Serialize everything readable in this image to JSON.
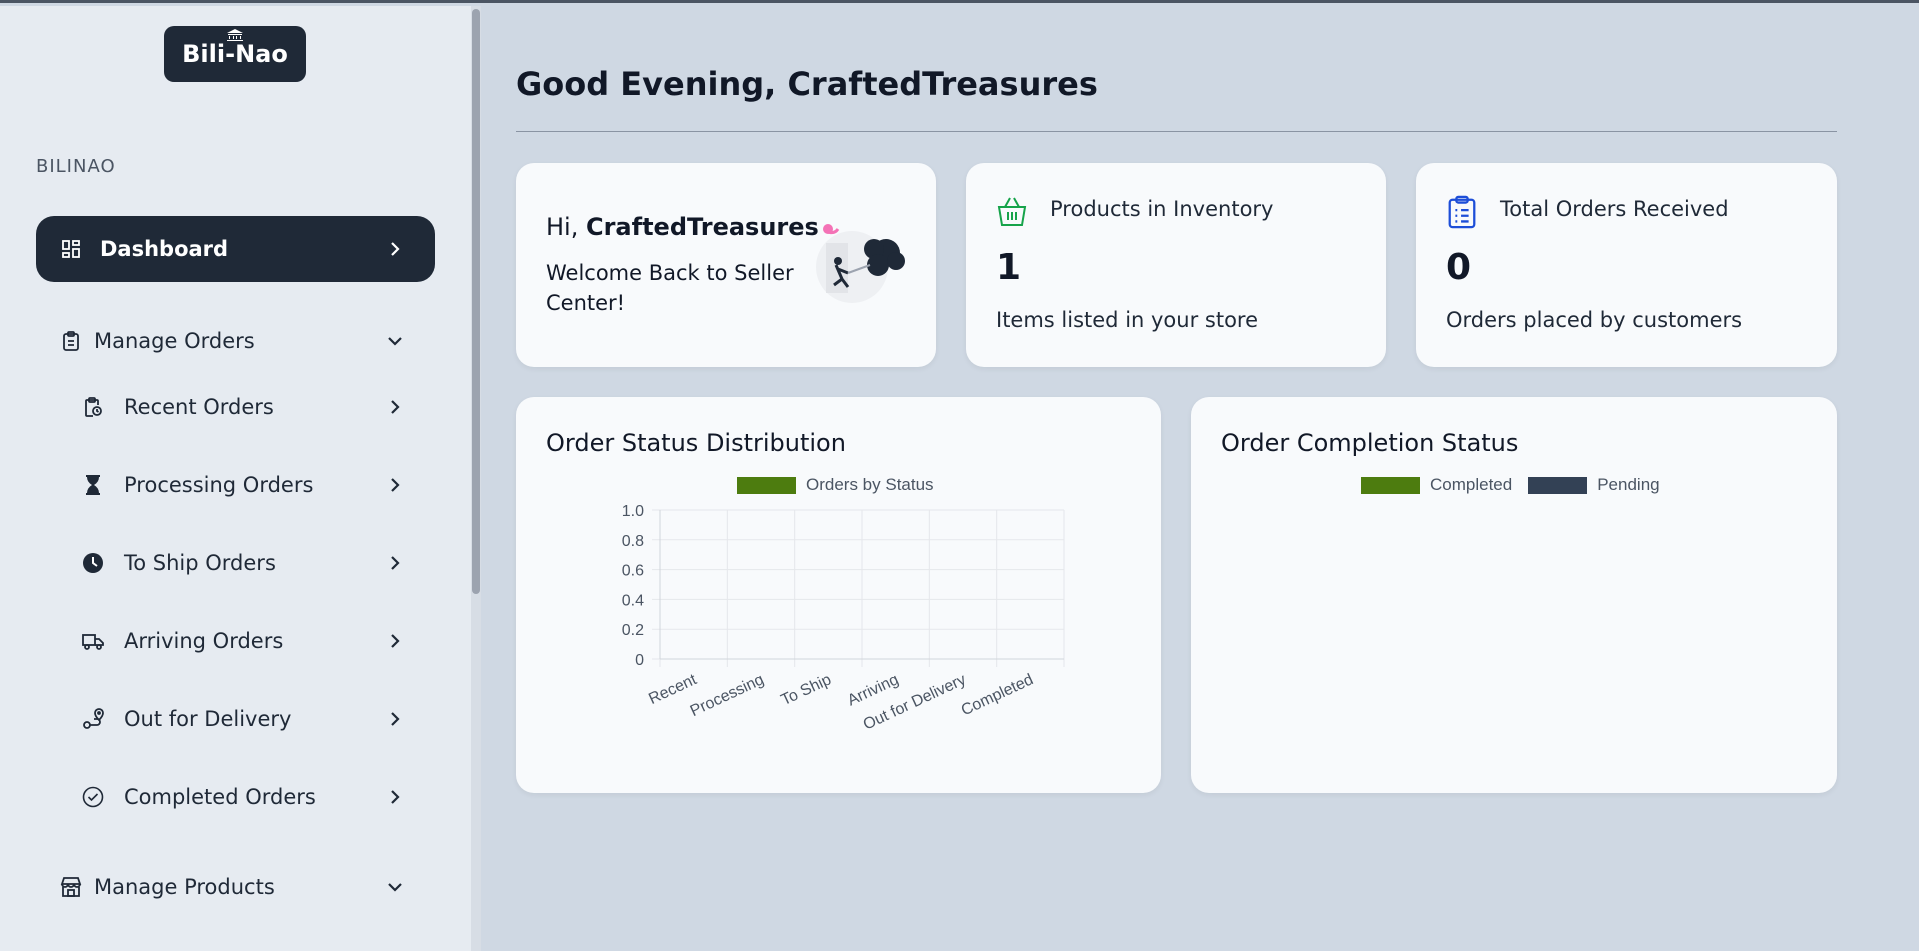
{
  "brand": {
    "logo_text": "Bili-Nao",
    "section_label": "BILINAO"
  },
  "sidebar": {
    "dashboard": "Dashboard",
    "manage_orders": "Manage Orders",
    "sub_items": [
      {
        "label": "Recent Orders",
        "icon": "clipboard-clock-icon"
      },
      {
        "label": "Processing Orders",
        "icon": "hourglass-icon"
      },
      {
        "label": "To Ship Orders",
        "icon": "clock-icon"
      },
      {
        "label": "Arriving Orders",
        "icon": "truck-icon"
      },
      {
        "label": "Out for Delivery",
        "icon": "route-icon"
      },
      {
        "label": "Completed Orders",
        "icon": "check-circle-icon"
      }
    ],
    "manage_products": "Manage Products"
  },
  "header": {
    "greeting_prefix": "Good Evening,",
    "username": "CraftedTreasures"
  },
  "welcome_card": {
    "hi": "Hi,",
    "username": "CraftedTreasures",
    "message": "Welcome Back to Seller Center!"
  },
  "inventory_card": {
    "title": "Products in Inventory",
    "value": "1",
    "desc": "Items listed in your store"
  },
  "orders_card": {
    "title": "Total Orders Received",
    "value": "0",
    "desc": "Orders placed by customers"
  },
  "colors": {
    "accent_dark": "#1f2937",
    "completed_green": "#4d7c0f",
    "pending_slate": "#334155",
    "inventory_icon": "#16a34a",
    "orders_icon": "#1d4ed8"
  },
  "chart_data": [
    {
      "type": "bar",
      "title": "Order Status Distribution",
      "categories": [
        "Recent",
        "Processing",
        "To Ship",
        "Arriving",
        "Out for Delivery",
        "Completed"
      ],
      "series": [
        {
          "name": "Orders by Status",
          "values": [
            0,
            0,
            0,
            0,
            0,
            0
          ]
        }
      ],
      "ylim": [
        0,
        1.0
      ],
      "yticks": [
        "1.0",
        "0.8",
        "0.6",
        "0.4",
        "0.2",
        "0"
      ],
      "legend": "top-center",
      "grid": true
    },
    {
      "type": "pie",
      "title": "Order Completion Status",
      "series": [
        {
          "name": "Completed",
          "values": [
            0
          ]
        },
        {
          "name": "Pending",
          "values": [
            0
          ]
        }
      ],
      "legend": "top-center"
    }
  ]
}
